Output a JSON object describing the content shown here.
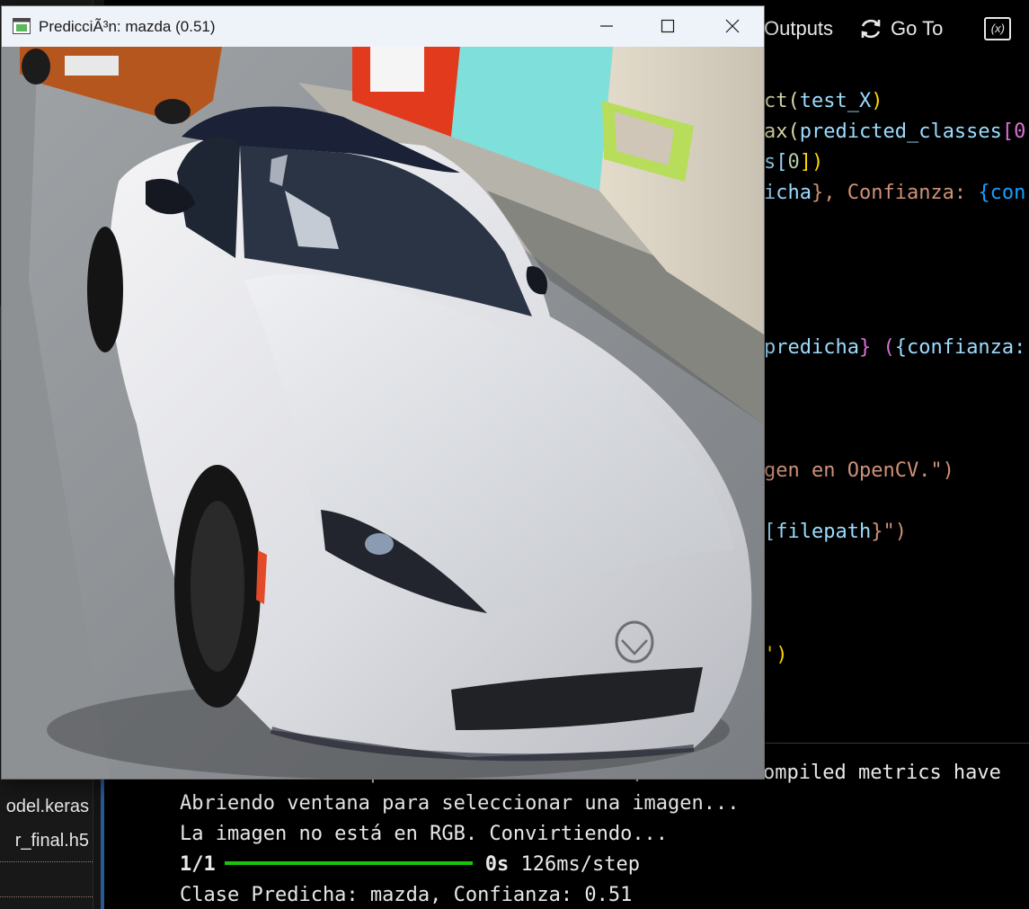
{
  "vscode": {
    "explorer": {
      "files": [
        "odel.keras",
        "r_final.h5"
      ]
    },
    "toolbar": {
      "outputs_label": "Outputs",
      "goto_label": "Go To"
    },
    "code_lines": [
      {
        "a": "ct(",
        "b": "test_X",
        "c": ")"
      },
      {
        "a": "ax(",
        "b": "predicted_classes",
        "c": "[0"
      },
      {
        "a": "s[",
        "b": "0",
        "c": "])"
      },
      {
        "a": "icha",
        "b": "}, Confianza: ",
        "c": "{con"
      },
      {
        "a": "predicha",
        "b": "} (",
        "c": "{confianza:"
      },
      {
        "a": "gen en OpenCV.\")"
      },
      {
        "a": "[filepath",
        "b": "}\")"
      },
      {
        "a": "')"
      }
    ],
    "output_lines": {
      "warning": "WARNING:absl:Compiled the loaded model, but the compiled metrics have",
      "line1": "Abriendo ventana para seleccionar una imagen...",
      "line2": "La imagen no está en RGB. Convirtiendo...",
      "progress_prefix": "1/1",
      "progress_fraction": 1.0,
      "progress_time": "0s",
      "progress_rate": "126ms/step",
      "result": "Clase Predicha: mazda, Confianza: 0.51"
    }
  },
  "cv_window": {
    "title": "PredicciÃ³n: mazda (0.51)",
    "icons": {
      "app": "app-window-icon",
      "minimize": "minimize-icon",
      "maximize": "maximize-icon",
      "close": "close-icon"
    }
  },
  "colors": {
    "progress": "#16c60c",
    "titlebar": "#eef2f9",
    "accent": "#3794ff"
  }
}
